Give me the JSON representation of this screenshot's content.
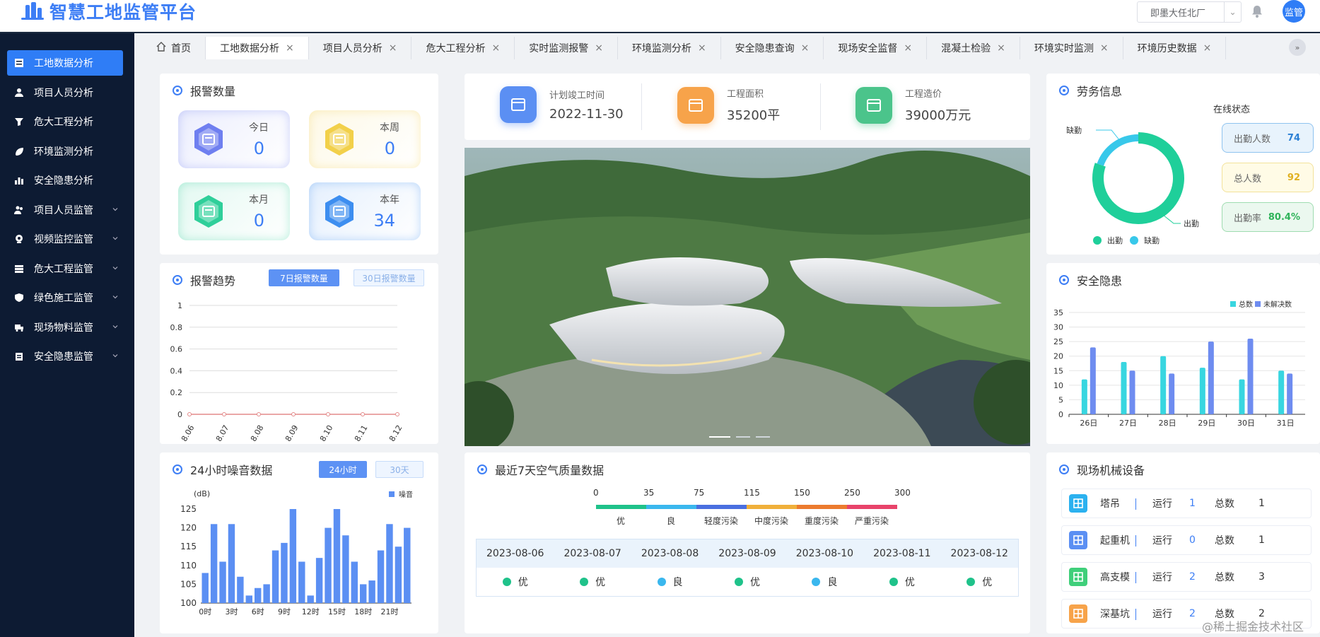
{
  "app": {
    "title": "智慧工地监管平台",
    "site": "即墨大任北厂",
    "avatar": "监管"
  },
  "sidebar": {
    "items": [
      {
        "label": "工地数据分析",
        "icon": "table-icon",
        "active": true,
        "expandable": false
      },
      {
        "label": "项目人员分析",
        "icon": "user-icon",
        "active": false,
        "expandable": false
      },
      {
        "label": "危大工程分析",
        "icon": "funnel-icon",
        "active": false,
        "expandable": false
      },
      {
        "label": "环境监测分析",
        "icon": "leaf-icon",
        "active": false,
        "expandable": false
      },
      {
        "label": "安全隐患分析",
        "icon": "bar-chart-icon",
        "active": false,
        "expandable": false
      },
      {
        "label": "项目人员监管",
        "icon": "users-icon",
        "active": false,
        "expandable": true
      },
      {
        "label": "视频监控监管",
        "icon": "camera-icon",
        "active": false,
        "expandable": true
      },
      {
        "label": "危大工程监管",
        "icon": "layers-icon",
        "active": false,
        "expandable": true
      },
      {
        "label": "绿色施工监管",
        "icon": "shield-icon",
        "active": false,
        "expandable": true
      },
      {
        "label": "现场物料监管",
        "icon": "truck-icon",
        "active": false,
        "expandable": true
      },
      {
        "label": "安全隐患监管",
        "icon": "clipboard-icon",
        "active": false,
        "expandable": true
      }
    ]
  },
  "tabs": [
    {
      "label": "首页",
      "closable": false,
      "home": true
    },
    {
      "label": "工地数据分析",
      "closable": true,
      "active": true
    },
    {
      "label": "项目人员分析",
      "closable": true
    },
    {
      "label": "危大工程分析",
      "closable": true
    },
    {
      "label": "实时监测报警",
      "closable": true
    },
    {
      "label": "环境监测分析",
      "closable": true
    },
    {
      "label": "安全隐患查询",
      "closable": true
    },
    {
      "label": "现场安全监督",
      "closable": true
    },
    {
      "label": "混凝土检验",
      "closable": true
    },
    {
      "label": "环境实时监测",
      "closable": true
    },
    {
      "label": "环境历史数据",
      "closable": true
    }
  ],
  "alarm_count": {
    "title": "报警数量",
    "items": [
      {
        "label": "今日",
        "value": "0",
        "color": "#6f7ff0"
      },
      {
        "label": "本周",
        "value": "0",
        "color": "#f2d04a"
      },
      {
        "label": "本月",
        "value": "0",
        "color": "#2fcf9a"
      },
      {
        "label": "本年",
        "value": "34",
        "color": "#3d8ef0"
      }
    ]
  },
  "alarm_trend": {
    "title": "报警趋势",
    "btn_7": "7日报警数量",
    "btn_30": "30日报警数量"
  },
  "noise": {
    "title": "24小时噪音数据",
    "btn_24h": "24小时",
    "btn_30d": "30天"
  },
  "project_info": [
    {
      "label": "计划竣工时间",
      "value": "2022-11-30",
      "color": "#5b8ff3",
      "icon": "calendar-icon"
    },
    {
      "label": "工程面积",
      "value": "35200平",
      "color": "#f7a34a",
      "icon": "area-icon"
    },
    {
      "label": "工程造价",
      "value": "39000万元",
      "color": "#4bc48b",
      "icon": "yuan-shield-icon"
    }
  ],
  "labor": {
    "title": "劳务信息",
    "online_title": "在线状态",
    "absent_label": "缺勤",
    "present_label": "出勤",
    "stats": [
      {
        "label": "出勤人数",
        "value": "74",
        "bg": "#e8f3fc",
        "border": "#8fc3ef",
        "color": "#2a7fd4"
      },
      {
        "label": "总人数",
        "value": "92",
        "bg": "#fffbe6",
        "border": "#f3e29a",
        "color": "#e0b020"
      },
      {
        "label": "出勤率",
        "value": "80.4%",
        "bg": "#ebf8ef",
        "border": "#9fdcb0",
        "color": "#2fb35a"
      }
    ]
  },
  "hazard": {
    "title": "安全隐患"
  },
  "air": {
    "title": "最近7天空气质量数据",
    "scale": {
      "nums": [
        "0",
        "35",
        "75",
        "115",
        "150",
        "250",
        "300"
      ],
      "levels": [
        {
          "label": "优",
          "color": "#1fc28a"
        },
        {
          "label": "良",
          "color": "#3ab7ee"
        },
        {
          "label": "轻度污染",
          "color": "#4a6fe0"
        },
        {
          "label": "中度污染",
          "color": "#f0b03a"
        },
        {
          "label": "重度污染",
          "color": "#ec7b2e"
        },
        {
          "label": "严重污染",
          "color": "#e8436a"
        }
      ]
    },
    "days": [
      {
        "date": "2023-08-06",
        "level": "优",
        "color": "#1fc28a"
      },
      {
        "date": "2023-08-07",
        "level": "优",
        "color": "#1fc28a"
      },
      {
        "date": "2023-08-08",
        "level": "良",
        "color": "#3ab7ee"
      },
      {
        "date": "2023-08-09",
        "level": "优",
        "color": "#1fc28a"
      },
      {
        "date": "2023-08-10",
        "level": "良",
        "color": "#3ab7ee"
      },
      {
        "date": "2023-08-11",
        "level": "优",
        "color": "#1fc28a"
      },
      {
        "date": "2023-08-12",
        "level": "优",
        "color": "#1fc28a"
      }
    ]
  },
  "machines": {
    "title": "现场机械设备",
    "run_label": "运行",
    "total_label": "总数",
    "items": [
      {
        "name": "塔吊",
        "run": "1",
        "total": "1",
        "color": "#2bb1ef",
        "icon": "tower-crane-icon"
      },
      {
        "name": "起重机",
        "run": "0",
        "total": "1",
        "color": "#5b8ff3",
        "icon": "crane-icon"
      },
      {
        "name": "高支模",
        "run": "2",
        "total": "3",
        "color": "#3fcf7a",
        "icon": "grid-icon"
      },
      {
        "name": "深基坑",
        "run": "2",
        "total": "2",
        "color": "#f7a34a",
        "icon": "pit-icon"
      }
    ]
  },
  "watermark": "@稀土掘金技术社区",
  "chart_data": [
    {
      "type": "line",
      "title": "",
      "x": [
        "8.06",
        "8.07",
        "8.08",
        "8.09",
        "8.10",
        "8.11",
        "8.12"
      ],
      "series": [
        {
          "values": [
            0,
            0,
            0,
            0,
            0,
            0,
            0
          ]
        }
      ],
      "ylim": [
        0,
        1
      ],
      "yticks": [
        "0",
        "0.2",
        "0.4",
        "0.6",
        "0.8",
        "1"
      ],
      "grid": true
    },
    {
      "type": "bar",
      "x": [
        "0时",
        "1时",
        "2时",
        "3时",
        "4时",
        "5时",
        "6时",
        "7时",
        "8时",
        "9时",
        "10时",
        "11时",
        "12时",
        "13时",
        "14时",
        "15时",
        "16时",
        "17时",
        "18时",
        "19时",
        "20时",
        "21时",
        "22时",
        "23时"
      ],
      "xticks": [
        "0时",
        "3时",
        "6时",
        "9时",
        "12时",
        "15时",
        "18时",
        "21时"
      ],
      "ylabel": "(dB)",
      "ylim": [
        100,
        125
      ],
      "yticks": [
        "100",
        "105",
        "110",
        "115",
        "120",
        "125"
      ],
      "series": [
        {
          "name": "噪音",
          "color": "#5b8ff3",
          "values": [
            108,
            121,
            111,
            121,
            107,
            102,
            104,
            105,
            114,
            116,
            125,
            111,
            102,
            112,
            120,
            125,
            118,
            111,
            105,
            106,
            114,
            121,
            115,
            120
          ]
        }
      ],
      "legend": "top-right"
    },
    {
      "type": "bar",
      "x": [
        "26日",
        "27日",
        "28日",
        "29日",
        "30日",
        "31日"
      ],
      "ylim": [
        0,
        35
      ],
      "yticks": [
        "0",
        "5",
        "10",
        "15",
        "20",
        "25",
        "30",
        "35"
      ],
      "series": [
        {
          "name": "总数",
          "color": "#38d6e0",
          "values": [
            12,
            18,
            20,
            16,
            12,
            15
          ]
        },
        {
          "name": "未解决数",
          "color": "#6e8cf0",
          "values": [
            23,
            15,
            14,
            25,
            26,
            14
          ]
        }
      ],
      "legend": "top-right",
      "grid": true
    },
    {
      "type": "pie",
      "series": [
        {
          "name": "出勤",
          "color": "#1fcf9a",
          "value": 74
        },
        {
          "name": "缺勤",
          "color": "#38c8ea",
          "value": 18
        }
      ],
      "legend": "bottom"
    }
  ]
}
